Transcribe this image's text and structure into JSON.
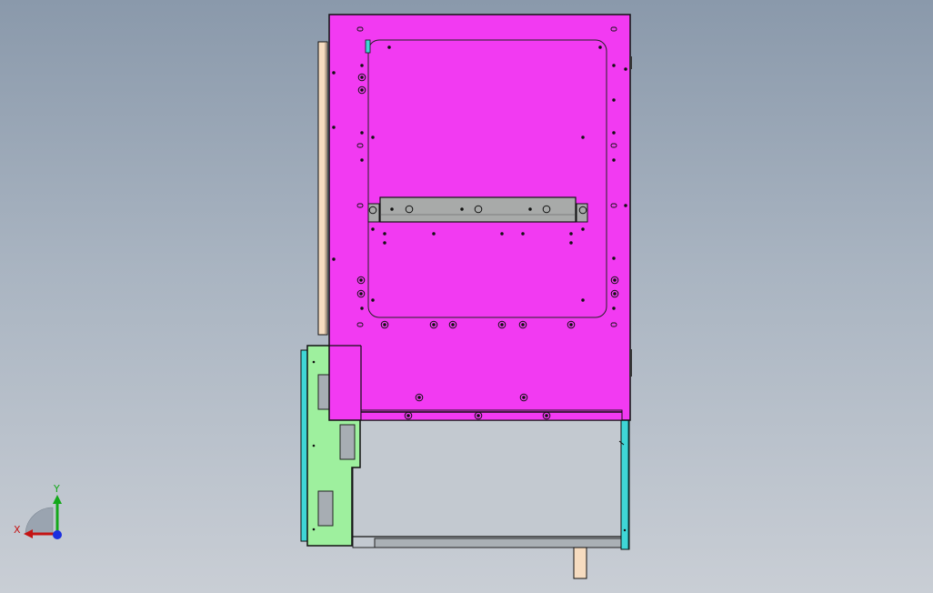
{
  "view": {
    "background_top": "#8a99ab",
    "background_bottom": "#c9ced5"
  },
  "colors": {
    "main_panel": "#f23af2",
    "side_bracket": "#9ef09e",
    "rail": "#3fd6d6",
    "wood_strip": "#f6dcc0",
    "lower_frame": "#c3c9d0",
    "cross_bar": "#a8aaa9",
    "edge": "#111111"
  },
  "triad": {
    "x_label": "X",
    "y_label": "Y",
    "x_color": "#c41414",
    "y_color": "#13a81a",
    "z_color": "#1a2ee0"
  }
}
